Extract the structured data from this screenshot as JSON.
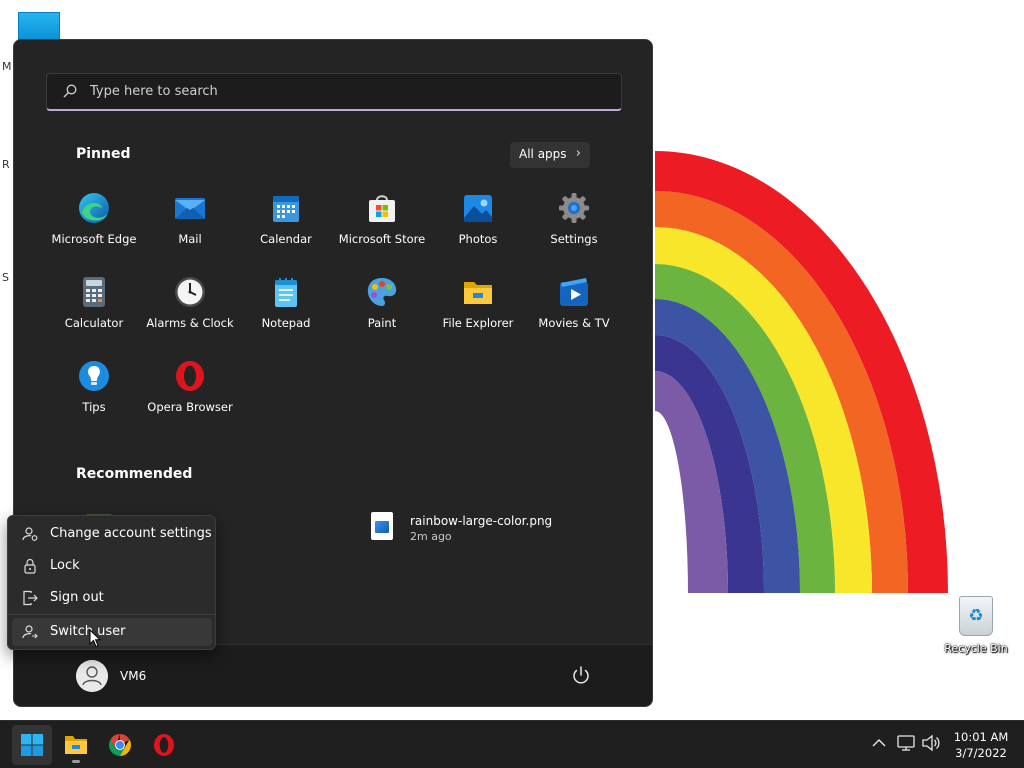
{
  "desktop": {
    "edge_letters": [
      "M",
      "R",
      "S"
    ],
    "recycle_bin_label": "Recycle Bin"
  },
  "start_menu": {
    "search": {
      "placeholder": "Type here to search"
    },
    "pinned": {
      "title": "Pinned",
      "all_apps_label": "All apps",
      "apps": [
        {
          "label": "Microsoft Edge",
          "icon": "edge-icon"
        },
        {
          "label": "Mail",
          "icon": "mail-icon"
        },
        {
          "label": "Calendar",
          "icon": "calendar-icon"
        },
        {
          "label": "Microsoft Store",
          "icon": "store-icon"
        },
        {
          "label": "Photos",
          "icon": "photos-icon"
        },
        {
          "label": "Settings",
          "icon": "gear-icon"
        },
        {
          "label": "Calculator",
          "icon": "calculator-icon"
        },
        {
          "label": "Alarms & Clock",
          "icon": "clock-icon"
        },
        {
          "label": "Notepad",
          "icon": "notepad-icon"
        },
        {
          "label": "Paint",
          "icon": "paint-palette-icon"
        },
        {
          "label": "File Explorer",
          "icon": "folder-icon"
        },
        {
          "label": "Movies & TV",
          "icon": "play-video-icon"
        },
        {
          "label": "Tips",
          "icon": "lightbulb-icon"
        },
        {
          "label": "Opera Browser",
          "icon": "opera-icon"
        }
      ]
    },
    "recommended": {
      "title": "Recommended",
      "items": [
        {
          "filename": "rainbow-large-color.png",
          "time": "2m ago",
          "icon": "image-file-icon"
        }
      ]
    },
    "account_menu": {
      "items": [
        {
          "label": "Change account settings",
          "icon": "account-settings-icon"
        },
        {
          "label": "Lock",
          "icon": "lock-icon"
        },
        {
          "label": "Sign out",
          "icon": "sign-out-icon"
        },
        {
          "label": "Switch user",
          "icon": "switch-user-icon",
          "hovered": true
        }
      ]
    },
    "footer": {
      "username": "VM6",
      "power_icon": "power-icon"
    }
  },
  "taskbar": {
    "apps": [
      {
        "name": "start",
        "icon": "windows-logo-icon",
        "active": true
      },
      {
        "name": "file-explorer",
        "icon": "folder-icon",
        "running": true
      },
      {
        "name": "chrome",
        "icon": "chrome-icon"
      },
      {
        "name": "opera",
        "icon": "opera-icon"
      }
    ],
    "tray_icons": [
      "chevron-up-icon",
      "network-icon",
      "volume-icon"
    ],
    "clock": {
      "time": "10:01 AM",
      "date": "3/7/2022"
    }
  },
  "colors": {
    "menu_bg": "#242424",
    "flyout_bg": "#2b2b2b",
    "taskbar_bg": "#1f1f1f",
    "search_accent": "#c3a6d9",
    "rainbow": [
      "#ed1c24",
      "#f26522",
      "#f7e62a",
      "#6ab43f",
      "#3d54a4",
      "#3a3590",
      "#7b5aa6"
    ]
  }
}
